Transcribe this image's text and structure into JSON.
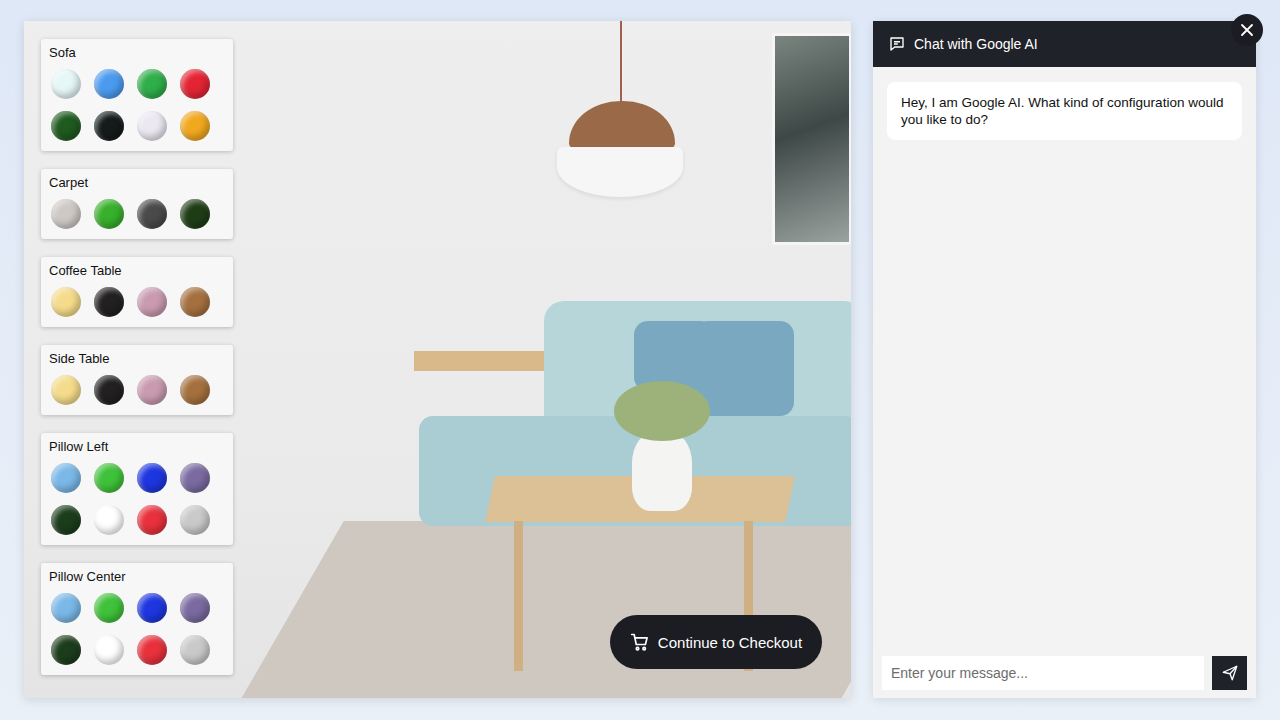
{
  "configurator": {
    "panels": [
      {
        "label": "Sofa",
        "swatches": [
          {
            "color": "#e6f7f8"
          },
          {
            "color": "#4a9bef"
          },
          {
            "color": "#2fae4a"
          },
          {
            "color": "#e42433"
          },
          {
            "color": "#1f5a1f"
          },
          {
            "color": "#151a1a"
          },
          {
            "color": "#ece8f2"
          },
          {
            "color": "#f0a81e"
          }
        ]
      },
      {
        "label": "Carpet",
        "swatches": [
          {
            "color": "#cfc9c6"
          },
          {
            "color": "#37b02b"
          },
          {
            "color": "#4a4a4a"
          },
          {
            "color": "#1e3d16"
          }
        ]
      },
      {
        "label": "Coffee Table",
        "swatches": [
          {
            "color": "#f5dc8a"
          },
          {
            "color": "#222020"
          },
          {
            "color": "#c99ab0"
          },
          {
            "color": "#a5703e"
          }
        ]
      },
      {
        "label": "Side Table",
        "swatches": [
          {
            "color": "#f5dc8a"
          },
          {
            "color": "#222020"
          },
          {
            "color": "#c99ab0"
          },
          {
            "color": "#a5703e"
          }
        ]
      },
      {
        "label": "Pillow Left",
        "swatches": [
          {
            "color": "#7ab8e8"
          },
          {
            "color": "#3fc23a"
          },
          {
            "color": "#1d36e0"
          },
          {
            "color": "#7a6aa0"
          },
          {
            "color": "#1c3d1c"
          },
          {
            "color": "#ffffff"
          },
          {
            "color": "#e8313d"
          },
          {
            "color": "#c9c9c9"
          }
        ]
      },
      {
        "label": "Pillow Center",
        "swatches": [
          {
            "color": "#7ab8e8"
          },
          {
            "color": "#3fc23a"
          },
          {
            "color": "#1d36e0"
          },
          {
            "color": "#7a6aa0"
          },
          {
            "color": "#1c3d1c"
          },
          {
            "color": "#ffffff"
          },
          {
            "color": "#e8313d"
          },
          {
            "color": "#c9c9c9"
          }
        ]
      }
    ],
    "checkout_button": "Continue to Checkout"
  },
  "chat": {
    "title": "Chat with Google AI",
    "messages": [
      {
        "from": "ai",
        "text": "Hey, I am Google AI. What kind of configuration would you like to do?"
      }
    ],
    "input": {
      "placeholder": "Enter your message..."
    }
  }
}
